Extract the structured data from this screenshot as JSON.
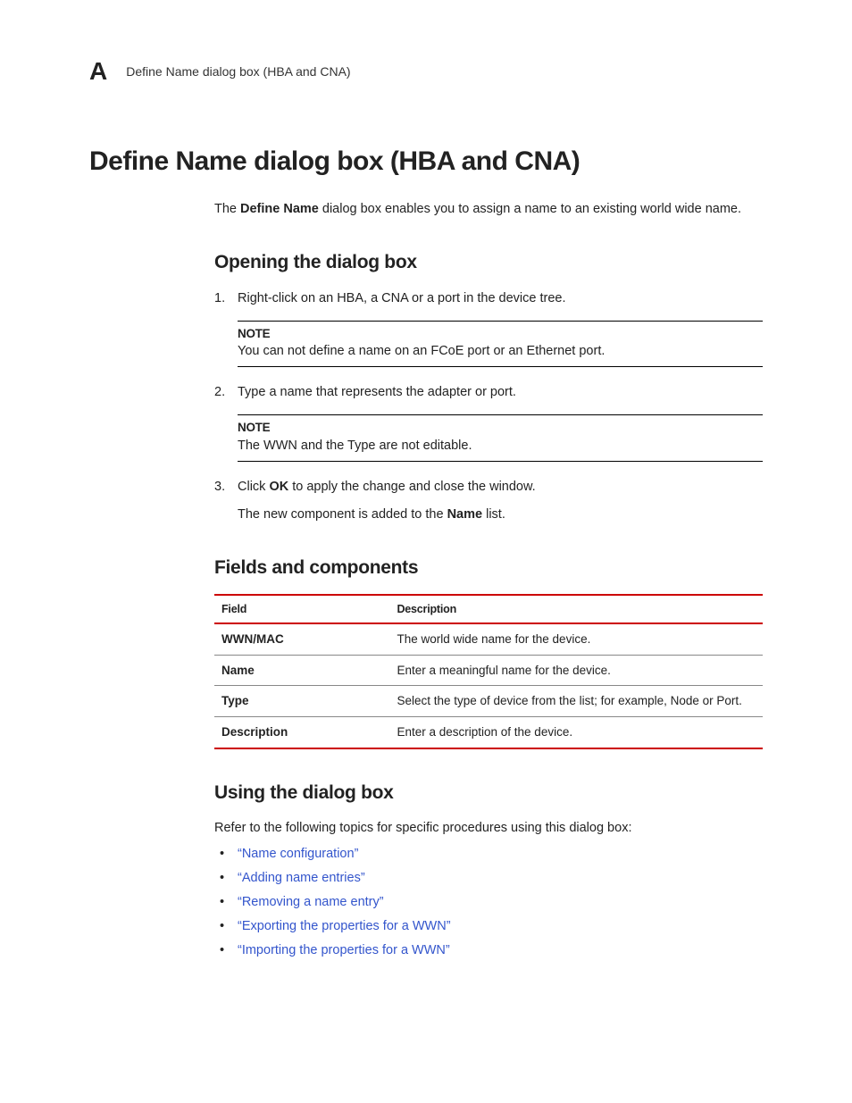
{
  "header": {
    "appendix_letter": "A",
    "breadcrumb": "Define Name dialog box (HBA and CNA)"
  },
  "title": "Define Name dialog box (HBA and CNA)",
  "intro": {
    "prefix": "The ",
    "bold": "Define Name",
    "suffix": " dialog box enables you to assign a name to an existing world wide name."
  },
  "section_opening": {
    "heading": "Opening the dialog box",
    "step1": "Right-click on an HBA, a CNA or a port in the device tree.",
    "note1_label": "NOTE",
    "note1_text": "You can not define a name on an FCoE port or an Ethernet port.",
    "step2": "Type a name that represents the adapter or port.",
    "note2_label": "NOTE",
    "note2_text": "The WWN and the Type are not editable.",
    "step3_prefix": "Click ",
    "step3_bold": "OK",
    "step3_suffix": " to apply the change and close the window.",
    "step3_after_prefix": "The new component is added to the ",
    "step3_after_bold": "Name",
    "step3_after_suffix": " list."
  },
  "section_fields": {
    "heading": "Fields and components",
    "th_field": "Field",
    "th_desc": "Description",
    "rows": [
      {
        "field": "WWN/MAC",
        "desc": "The world wide name for the device."
      },
      {
        "field": "Name",
        "desc": "Enter a meaningful name for the device."
      },
      {
        "field": "Type",
        "desc": "Select the type of device from the list; for example, Node or Port."
      },
      {
        "field": "Description",
        "desc": "Enter a description of the device."
      }
    ]
  },
  "section_using": {
    "heading": "Using the dialog box",
    "intro": "Refer to the following topics for specific procedures using this dialog box:",
    "links": [
      "“Name configuration”",
      "“Adding name entries”",
      "“Removing a name entry”",
      "“Exporting the properties for a WWN”",
      "“Importing the properties for a WWN”"
    ]
  }
}
